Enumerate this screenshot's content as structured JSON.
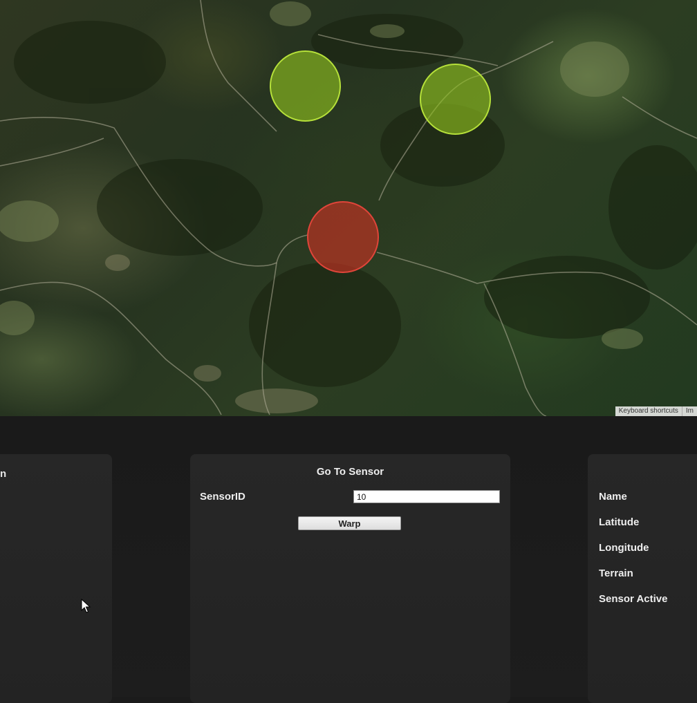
{
  "map": {
    "attribution": [
      "Keyboard shortcuts",
      "Im"
    ],
    "sensors": [
      {
        "status": "active",
        "color": "#92c41e"
      },
      {
        "status": "active",
        "color": "#92c41e"
      },
      {
        "status": "inactive",
        "color": "#cd3223"
      }
    ]
  },
  "left_panel": {
    "partial_text": "n"
  },
  "goto_panel": {
    "title": "Go To Sensor",
    "sensor_id_label": "SensorID",
    "sensor_id_value": "10",
    "warp_label": "Warp"
  },
  "info_panel": {
    "labels": [
      "Name",
      "Latitude",
      "Longitude",
      "Terrain",
      "Sensor Active"
    ]
  }
}
